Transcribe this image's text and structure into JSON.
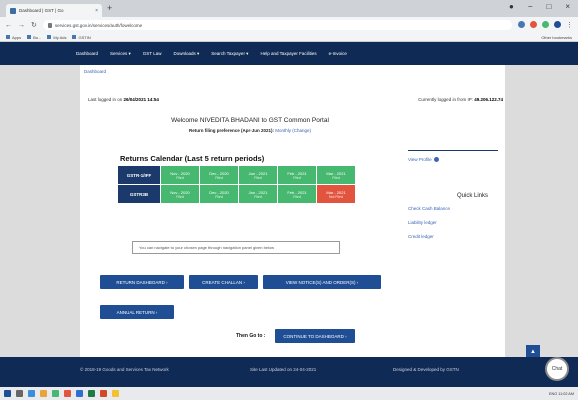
{
  "browser": {
    "tab_title": "Dashboard | GST | Go",
    "tab_close": "×",
    "new_tab": "+",
    "window_controls": [
      "●",
      "−",
      "□",
      "×"
    ],
    "url": "services.gst.gov.in/services/auth/fowelcome",
    "bookmarks": [
      "Apps",
      "Bo...",
      "My Ads",
      "GSTIN"
    ],
    "bookmarks_right": "Other bookmarks"
  },
  "menu": {
    "items": [
      "Dashboard",
      "Services ▾",
      "GST Law",
      "Downloads ▾",
      "Search Taxpayer ▾",
      "Help and Taxpayer Facilities",
      "e-Invoice"
    ]
  },
  "breadcrumb": "Dashboard",
  "login": {
    "prefix": "Last logged in on",
    "datetime": "26/04/2021 14:54",
    "ip_prefix": "Currently logged in from IP:",
    "ip": "49.206.122.74"
  },
  "welcome": "Welcome NIVEDITA BHADANI to GST Common Portal",
  "preference": {
    "label": "Return filing preference (Apr-Jun 2021):",
    "value": "Monthly",
    "change": "(Change)"
  },
  "returns_calendar": {
    "title": "Returns Calendar (Last 5 return periods)",
    "rows": [
      {
        "label": "GSTR-1/IFF",
        "cells": [
          {
            "month": "Nov - 2020",
            "status": "Filed",
            "color": "#47b870"
          },
          {
            "month": "Dec - 2020",
            "status": "Filed",
            "color": "#47b870"
          },
          {
            "month": "Jan - 2021",
            "status": "Filed",
            "color": "#47b870"
          },
          {
            "month": "Feb - 2021",
            "status": "Filed",
            "color": "#47b870"
          },
          {
            "month": "Mar - 2021",
            "status": "Filed",
            "color": "#47b870"
          }
        ]
      },
      {
        "label": "GSTR3B",
        "cells": [
          {
            "month": "Nov - 2020",
            "status": "Filed",
            "color": "#47b870"
          },
          {
            "month": "Dec - 2020",
            "status": "Filed",
            "color": "#47b870"
          },
          {
            "month": "Jan - 2021",
            "status": "Filed",
            "color": "#47b870"
          },
          {
            "month": "Feb - 2021",
            "status": "Filed",
            "color": "#47b870"
          },
          {
            "month": "Mar - 2021",
            "status": "Not Filed",
            "color": "#e2543e"
          }
        ]
      }
    ]
  },
  "nav_hint": "You can navigate to your chosen page through navigation panel given below",
  "buttons": {
    "return_dashboard": "RETURN DASHBOARD ›",
    "create_challan": "CREATE CHALLAN ›",
    "view_notices": "VIEW NOTICE(S) AND ORDER(S) ›",
    "annual_return": "ANNUAL RETURN ›",
    "continue": "CONTINUE TO DASHBOARD ›",
    "then_go_to": "Then Go to :",
    "scroll_top": "▲"
  },
  "right_panel": {
    "view_profile": "View Profile",
    "quick_links_title": "Quick Links",
    "links": [
      "Check Cash Balance",
      "Liability ledger",
      "Credit ledger"
    ]
  },
  "footer": {
    "copyright": "© 2018-19 Goods and Services Tax Network",
    "updated": "Site Last Updated on 24-04-2021",
    "designed": "Designed & Developed by GSTN",
    "chat": "Chat"
  },
  "taskbar": {
    "tray": "ENG 11:02 AM"
  },
  "colors": {
    "nav_bg": "#0f2a54",
    "button_bg": "#1f4e94",
    "filed": "#47b870",
    "not_filed": "#e2543e"
  }
}
